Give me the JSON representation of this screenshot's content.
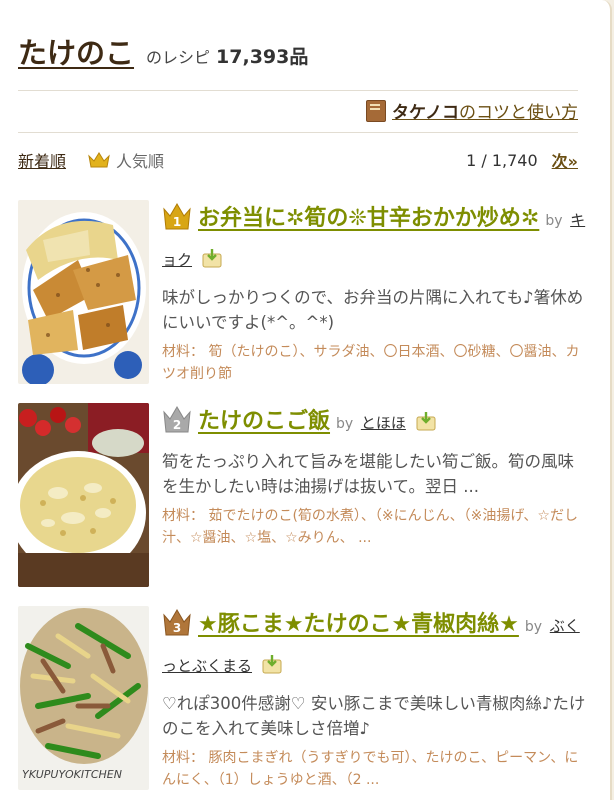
{
  "header": {
    "keyword": "たけのこ",
    "suffix": "のレシピ",
    "count": "17,393品"
  },
  "tips": {
    "keyword": "タケノコ",
    "suffix": "のコツと使い方"
  },
  "sort": {
    "newest": "新着順",
    "popular": "人気順",
    "pager": "1 / 1,740",
    "next": "次»"
  },
  "recipes": [
    {
      "rank": "1",
      "title": "お弁当に✲筍の❊甘辛おかか炒め✲",
      "by": "by",
      "author": "キョク",
      "description": "味がしっかりつくので、お弁当の片隅に入れても♪箸休めにいいですよ(*^。^*)",
      "ingredients": "材料： 筍（たけのこ）、サラダ油、〇日本酒、〇砂糖、〇醤油、カツオ削り節"
    },
    {
      "rank": "2",
      "title": "たけのこご飯",
      "by": "by",
      "author": "とほほ",
      "description": "筍をたっぷり入れて旨みを堪能したい筍ご飯。筍の風味を生かしたい時は油揚げは抜いて。翌日 ...",
      "ingredients": "材料： 茹でたけのこ(筍の水煮）、（※にんじん、（※油揚げ、☆だし汁、☆醤油、☆塩、☆みりん、 ..."
    },
    {
      "rank": "3",
      "title": "★豚こま★たけのこ★青椒肉絲★",
      "by": "by",
      "author": "ぶくっとぶくまる",
      "description": "♡れぽ300件感謝♡ 安い豚こまで美味しい青椒肉絲♪たけのこを入れて美味しさ倍増♪",
      "ingredients": "材料： 豚肉こまぎれ（うすぎりでも可）、たけのこ、ピーマン、にんにく、（1）しょうゆと酒、（2 ...",
      "watermark": "YKUPUYOKITCHEN"
    }
  ],
  "colors": {
    "title_green": "#7e8e00",
    "gold": "#d8a615",
    "silver": "#a9a9a9",
    "bronze": "#b0763a",
    "brown": "#3e2a14",
    "ingredient": "#c48b5a"
  }
}
